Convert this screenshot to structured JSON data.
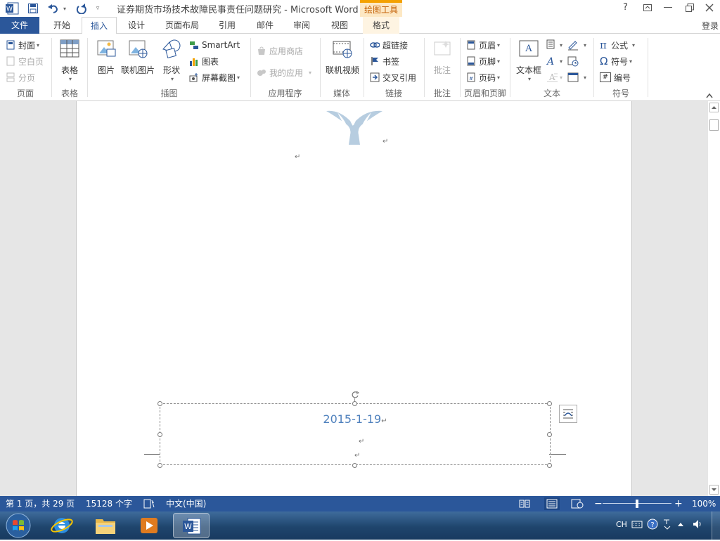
{
  "window": {
    "title": "证券期货市场技术故障民事责任问题研究 - Microsoft Word",
    "contextual_tab": "绘图工具",
    "help": "?",
    "signin": "登录"
  },
  "qat": {
    "icons": [
      "word-app-icon",
      "save-icon",
      "undo-icon",
      "redo-icon",
      "customize-icon"
    ]
  },
  "tabs": [
    "文件",
    "开始",
    "插入",
    "设计",
    "页面布局",
    "引用",
    "邮件",
    "审阅",
    "视图",
    "格式"
  ],
  "active_tab": "插入",
  "ribbon": {
    "pages": {
      "label": "页面",
      "items": [
        "封面",
        "空白页",
        "分页"
      ]
    },
    "tables": {
      "label": "表格",
      "button": "表格"
    },
    "illustrations": {
      "label": "插图",
      "big": [
        "图片",
        "联机图片",
        "形状"
      ],
      "small": [
        "SmartArt",
        "图表",
        "屏幕截图"
      ]
    },
    "apps": {
      "label": "应用程序",
      "items": [
        "应用商店",
        "我的应用"
      ]
    },
    "media": {
      "label": "媒体",
      "button": "联机视频"
    },
    "links": {
      "label": "链接",
      "items": [
        "超链接",
        "书签",
        "交叉引用"
      ]
    },
    "comments": {
      "label": "批注",
      "button": "批注"
    },
    "header_footer": {
      "label": "页眉和页脚",
      "items": [
        "页眉",
        "页脚",
        "页码"
      ]
    },
    "text": {
      "label": "文本",
      "button": "文本框"
    },
    "symbols": {
      "label": "符号",
      "items": [
        "公式",
        "符号",
        "编号"
      ],
      "glyphs": [
        "π",
        "Ω",
        "#"
      ]
    }
  },
  "document": {
    "textbox_text": "2015-1-19",
    "paragraph_mark": "↵"
  },
  "status": {
    "page": "第 1 页，共 29 页",
    "words": "15128 个字",
    "language": "中文(中国)",
    "zoom": "100%",
    "zoom_minus": "−",
    "zoom_plus": "+"
  },
  "taskbar": {
    "items": [
      "start-orb",
      "internet-explorer",
      "file-explorer",
      "media-player",
      "word"
    ],
    "lang": "CH"
  },
  "colors": {
    "accent": "#2b579a",
    "contextual": "#f4a100",
    "textbox_text": "#4f81bd",
    "logo": "#b7cde0"
  }
}
